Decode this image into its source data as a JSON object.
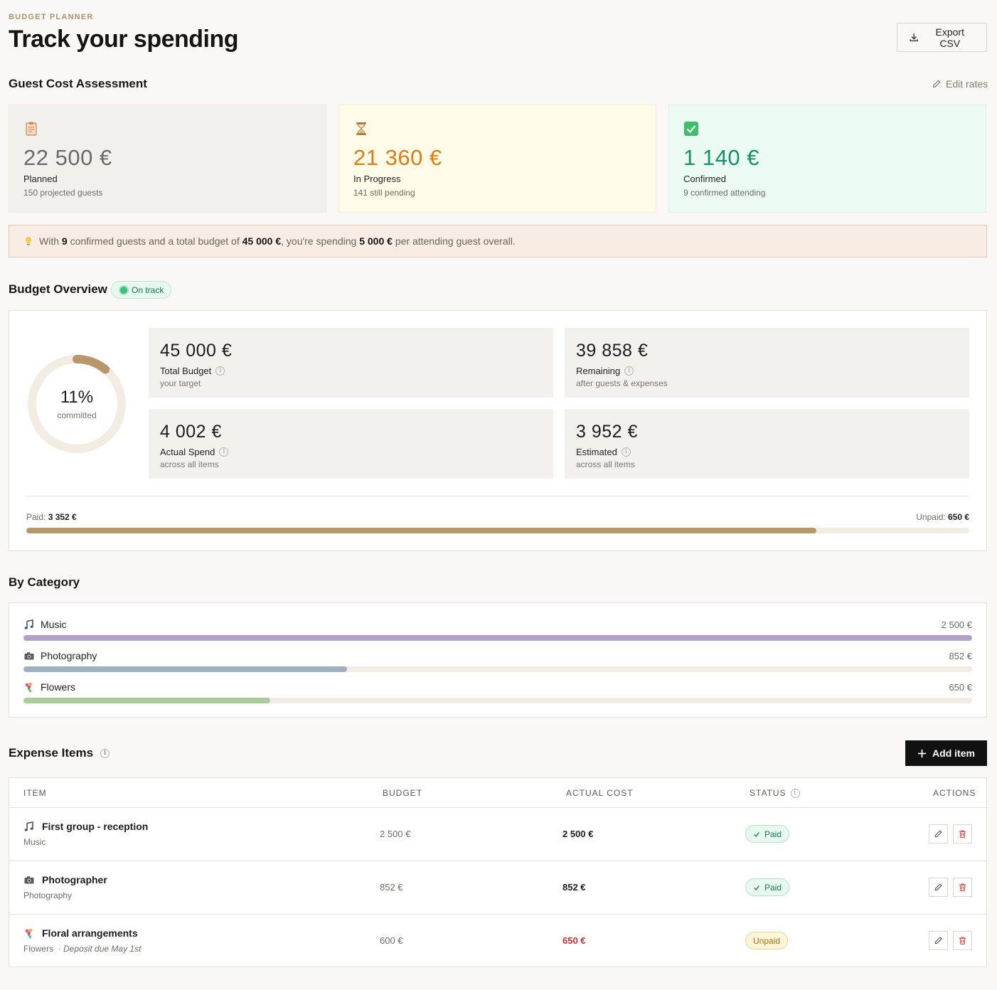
{
  "header": {
    "eyebrow": "BUDGET PLANNER",
    "title": "Track your spending",
    "export_label": "Export CSV"
  },
  "guest_cost": {
    "title": "Guest Cost Assessment",
    "edit_label": "Edit rates",
    "cards": [
      {
        "icon": "clipboard-icon",
        "value": "22 500 €",
        "label": "Planned",
        "sub": "150 projected guests"
      },
      {
        "icon": "hourglass-icon",
        "value": "21 360 €",
        "label": "In Progress",
        "sub": "141 still pending"
      },
      {
        "icon": "checkmark-icon",
        "value": "1 140 €",
        "label": "Confirmed",
        "sub": "9 confirmed attending"
      }
    ],
    "insight": {
      "t1": "With ",
      "guests": "9",
      "t2": " confirmed guests and a total budget of ",
      "budget": "45 000 €",
      "t3": ", you're spending ",
      "per_guest": "5 000 €",
      "t4": " per attending guest overall."
    }
  },
  "overview": {
    "title": "Budget Overview",
    "status": "On track",
    "committed_percent": 11,
    "committed_pct_label": "11%",
    "committed_label": "committed",
    "metrics": [
      {
        "value": "45 000 €",
        "label": "Total Budget",
        "sub": "your target"
      },
      {
        "value": "39 858 €",
        "label": "Remaining",
        "sub": "after guests & expenses"
      },
      {
        "value": "4 002 €",
        "label": "Actual Spend",
        "sub": "across all items"
      },
      {
        "value": "3 952 €",
        "label": "Estimated",
        "sub": "across all items"
      }
    ],
    "paid_label": "Paid: ",
    "paid_value": "3 352 €",
    "unpaid_label": "Unpaid: ",
    "unpaid_value": "650 €",
    "paid_fraction": 0.8376
  },
  "categories": {
    "title": "By Category",
    "items": [
      {
        "name": "Music",
        "icon": "music-note-icon",
        "amount": "2 500 €",
        "fraction": 1.0,
        "color": "#b29fca"
      },
      {
        "name": "Photography",
        "icon": "camera-icon",
        "amount": "852 €",
        "fraction": 0.3408,
        "color": "#9eb0c4"
      },
      {
        "name": "Flowers",
        "icon": "bouquet-icon",
        "amount": "650 €",
        "fraction": 0.26,
        "color": "#a8cc9a"
      }
    ]
  },
  "expenses": {
    "title": "Expense Items",
    "add_label": "Add item",
    "columns": {
      "item": "ITEM",
      "budget": "BUDGET",
      "actual": "ACTUAL COST",
      "status": "STATUS",
      "actions": "ACTIONS"
    },
    "rows": [
      {
        "icon": "music-note-icon",
        "name": "First group - reception",
        "category": "Music",
        "note": "",
        "budget": "2 500 €",
        "actual": "2 500 €",
        "over": false,
        "status": "Paid"
      },
      {
        "icon": "camera-icon",
        "name": "Photographer",
        "category": "Photography",
        "note": "",
        "budget": "852 €",
        "actual": "852 €",
        "over": false,
        "status": "Paid"
      },
      {
        "icon": "bouquet-icon",
        "name": "Floral arrangements",
        "category": "Flowers",
        "note": "· Deposit due May 1st",
        "budget": "600 €",
        "actual": "650 €",
        "over": true,
        "status": "Unpaid"
      }
    ]
  },
  "colors": {
    "accent": "#b8976a",
    "paid_fill": "#b8976a",
    "track": "#f3ece3"
  }
}
